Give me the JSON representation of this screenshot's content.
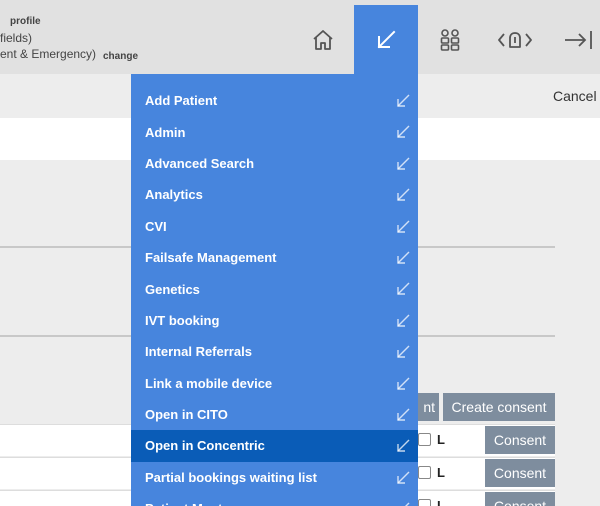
{
  "header": {
    "profile_label": "profile",
    "fields_text": "fields)",
    "consent_text": "ent & Emergency)",
    "change_label": "change"
  },
  "nav": {
    "home": "home-icon",
    "shortcuts": "arrow-down-left-icon",
    "people": "people-icon",
    "tools": "tools-icon",
    "logout": "logout-icon",
    "active_color": "#4785dd"
  },
  "actions": {
    "cancel_label": "Cancel"
  },
  "shortcuts_menu": {
    "items": [
      {
        "label": "Add Patient"
      },
      {
        "label": "Admin"
      },
      {
        "label": "Advanced Search"
      },
      {
        "label": "Analytics"
      },
      {
        "label": "CVI"
      },
      {
        "label": "Failsafe Management"
      },
      {
        "label": "Genetics"
      },
      {
        "label": "IVT booking"
      },
      {
        "label": "Internal Referrals"
      },
      {
        "label": "Link a mobile device"
      },
      {
        "label": "Open in CITO"
      },
      {
        "label": "Open in Concentric"
      },
      {
        "label": "Partial bookings waiting list"
      },
      {
        "label": "Patient Most..."
      }
    ],
    "active_index": 11,
    "menu_color": "#4785dd",
    "active_color": "#0a5cb7"
  },
  "consent_table": {
    "header_partial": "nt",
    "create_label": "Create consent",
    "rows": [
      {
        "letter": "L",
        "consent_label": "Consent"
      },
      {
        "letter": "L",
        "consent_label": "Consent"
      },
      {
        "letter": "L",
        "consent_label": "Consent"
      }
    ]
  }
}
